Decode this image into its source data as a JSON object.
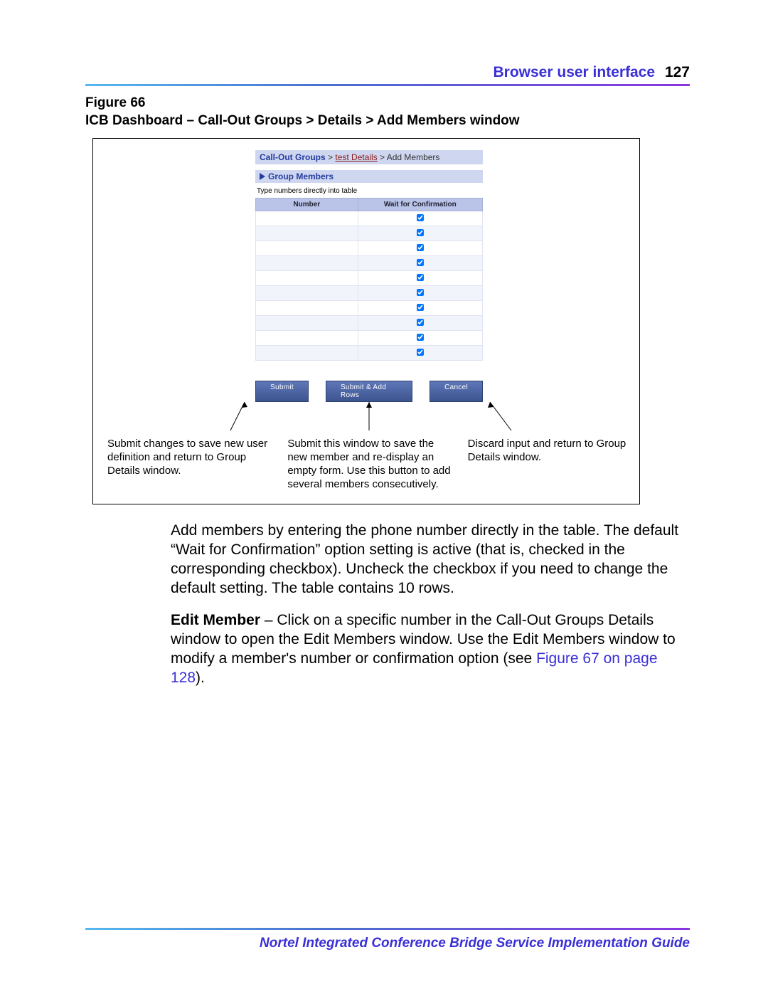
{
  "header": {
    "section": "Browser user interface",
    "page": "127"
  },
  "figure": {
    "label_line1": "Figure 66",
    "label_line2": "ICB Dashboard – Call-Out Groups > Details > Add Members window",
    "breadcrumb": {
      "root": "Call-Out Groups",
      "sep1": " > ",
      "mid": "test Details",
      "sep2": " > ",
      "tail": "Add Members"
    },
    "section_title": "Group Members",
    "instruction": "Type numbers directly into table",
    "columns": {
      "number": "Number",
      "wait": "Wait for Confirmation"
    },
    "row_count": 10,
    "buttons": {
      "submit": "Submit",
      "submit_add": "Submit & Add Rows",
      "cancel": "Cancel"
    },
    "callouts": {
      "submit": "Submit changes to save new user definition and return to Group Details window.",
      "submit_add": "Submit this window to save the new member and re-display an empty form. Use this button to add several members consecutively.",
      "cancel": "Discard input and return to Group Details window."
    }
  },
  "body": {
    "p1": "Add members by entering the phone number directly in the table. The default “Wait for Confirmation” option setting is active (that is, checked in the corresponding checkbox). Uncheck the checkbox if you need to change the default setting. The table contains 10 rows.",
    "p2_lead": "Edit Member",
    "p2_rest": " – Click on a specific number in the Call-Out Groups Details window to open the Edit Members window. Use the Edit Members window to modify a member's number or confirmation option (see ",
    "p2_xref": "Figure 67 on page 128",
    "p2_tail": ")."
  },
  "footer": {
    "title": "Nortel Integrated Conference Bridge Service Implementation Guide"
  }
}
